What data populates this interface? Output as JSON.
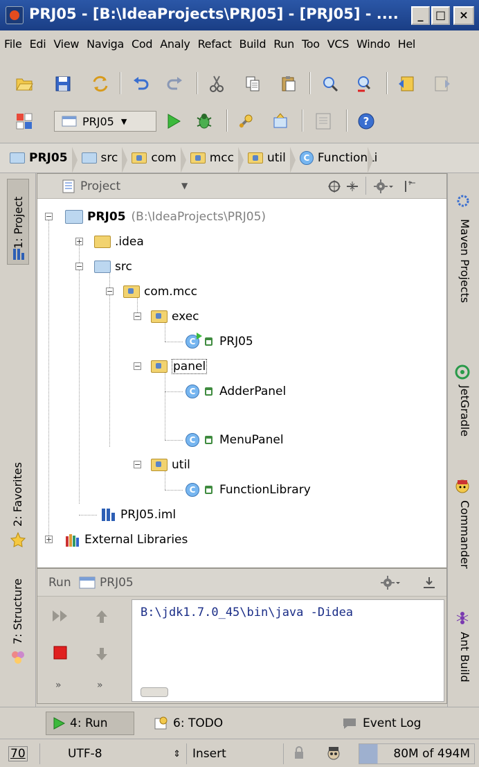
{
  "window": {
    "title": "PRJ05 - [B:\\IdeaProjects\\PRJ05] - [PRJ05] - ....",
    "min": "_",
    "max": "□",
    "close": "×"
  },
  "menu": [
    "File",
    "Edi",
    "View",
    "Naviga",
    "Cod",
    "Analy",
    "Refact",
    "Build",
    "Run",
    "Too",
    "VCS",
    "Windo",
    "Hel"
  ],
  "toolbar": {
    "run_config": "PRJ05"
  },
  "breadcrumb": [
    "PRJ05",
    "src",
    "com",
    "mcc",
    "util",
    "FunctionLi"
  ],
  "left_tabs": {
    "project": "1: Project",
    "favorites": "2: Favorites",
    "structure": "7: Structure"
  },
  "right_tabs": {
    "maven": "Maven Projects",
    "jetgradle": "JetGradle",
    "commander": "Commander",
    "ant": "Ant Build"
  },
  "project_panel": {
    "title": "Project",
    "tree": {
      "root_name": "PRJ05",
      "root_path": "(B:\\IdeaProjects\\PRJ05)",
      "idea": ".idea",
      "src": "src",
      "pkg": "com.mcc",
      "exec": "exec",
      "exec_class": "PRJ05",
      "panel": "panel",
      "adder": "AdderPanel",
      "menu": "MenuPanel",
      "util": "util",
      "funclib": "FunctionLibrary",
      "iml": "PRJ05.iml",
      "extlib": "External Libraries"
    }
  },
  "run_panel": {
    "label": "Run",
    "config": "PRJ05",
    "console_line": "B:\\jdk1.7.0_45\\bin\\java -Didea"
  },
  "bottom_tabs": {
    "run": "4: Run",
    "todo": "6: TODO",
    "event_log": "Event Log"
  },
  "status": {
    "position": "70",
    "encoding": "UTF-8",
    "mode": "Insert",
    "memory": "80M of 494M"
  }
}
